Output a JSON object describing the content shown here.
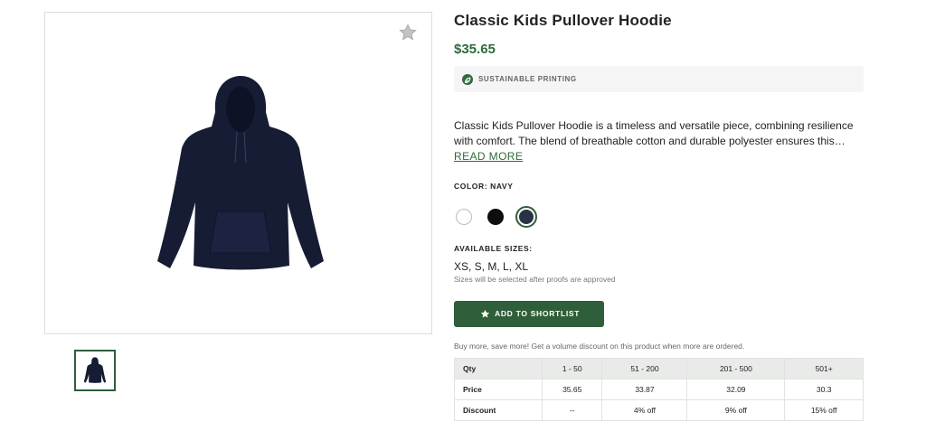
{
  "product": {
    "title": "Classic Kids Pullover Hoodie",
    "price": "$35.65",
    "badge": "SUSTAINABLE PRINTING",
    "description": "Classic Kids Pullover Hoodie is a timeless and versatile piece, combining resilience with comfort. The blend of breathable cotton and durable polyester ensures this…",
    "read_more": "READ MORE",
    "color_label": "COLOR: NAVY",
    "colors": [
      {
        "name": "white",
        "hex": "#ffffff"
      },
      {
        "name": "black",
        "hex": "#0e0e0e"
      },
      {
        "name": "navy",
        "hex": "#2a3142",
        "selected": true
      }
    ],
    "sizes_label": "AVAILABLE SIZES:",
    "sizes": "XS, S, M, L, XL",
    "sizes_note": "Sizes will be selected after proofs are approved",
    "shortlist_button": "ADD TO SHORTLIST",
    "promo": "Buy more, save more! Get a volume discount on this product when more are ordered."
  },
  "pricing_table": {
    "headers": [
      "Qty",
      "1 - 50",
      "51 - 200",
      "201 - 500",
      "501+"
    ],
    "rows": [
      [
        "Price",
        "35.65",
        "33.87",
        "32.09",
        "30.3"
      ],
      [
        "Discount",
        "--",
        "4% off",
        "9% off",
        "15% off"
      ]
    ]
  },
  "colors": {
    "accent": "#2e6b3a",
    "button": "#2f5e3a",
    "garment": "#161c33"
  },
  "icons": {
    "favorite": "star-icon",
    "badge": "leaf-icon",
    "button": "star-icon"
  }
}
